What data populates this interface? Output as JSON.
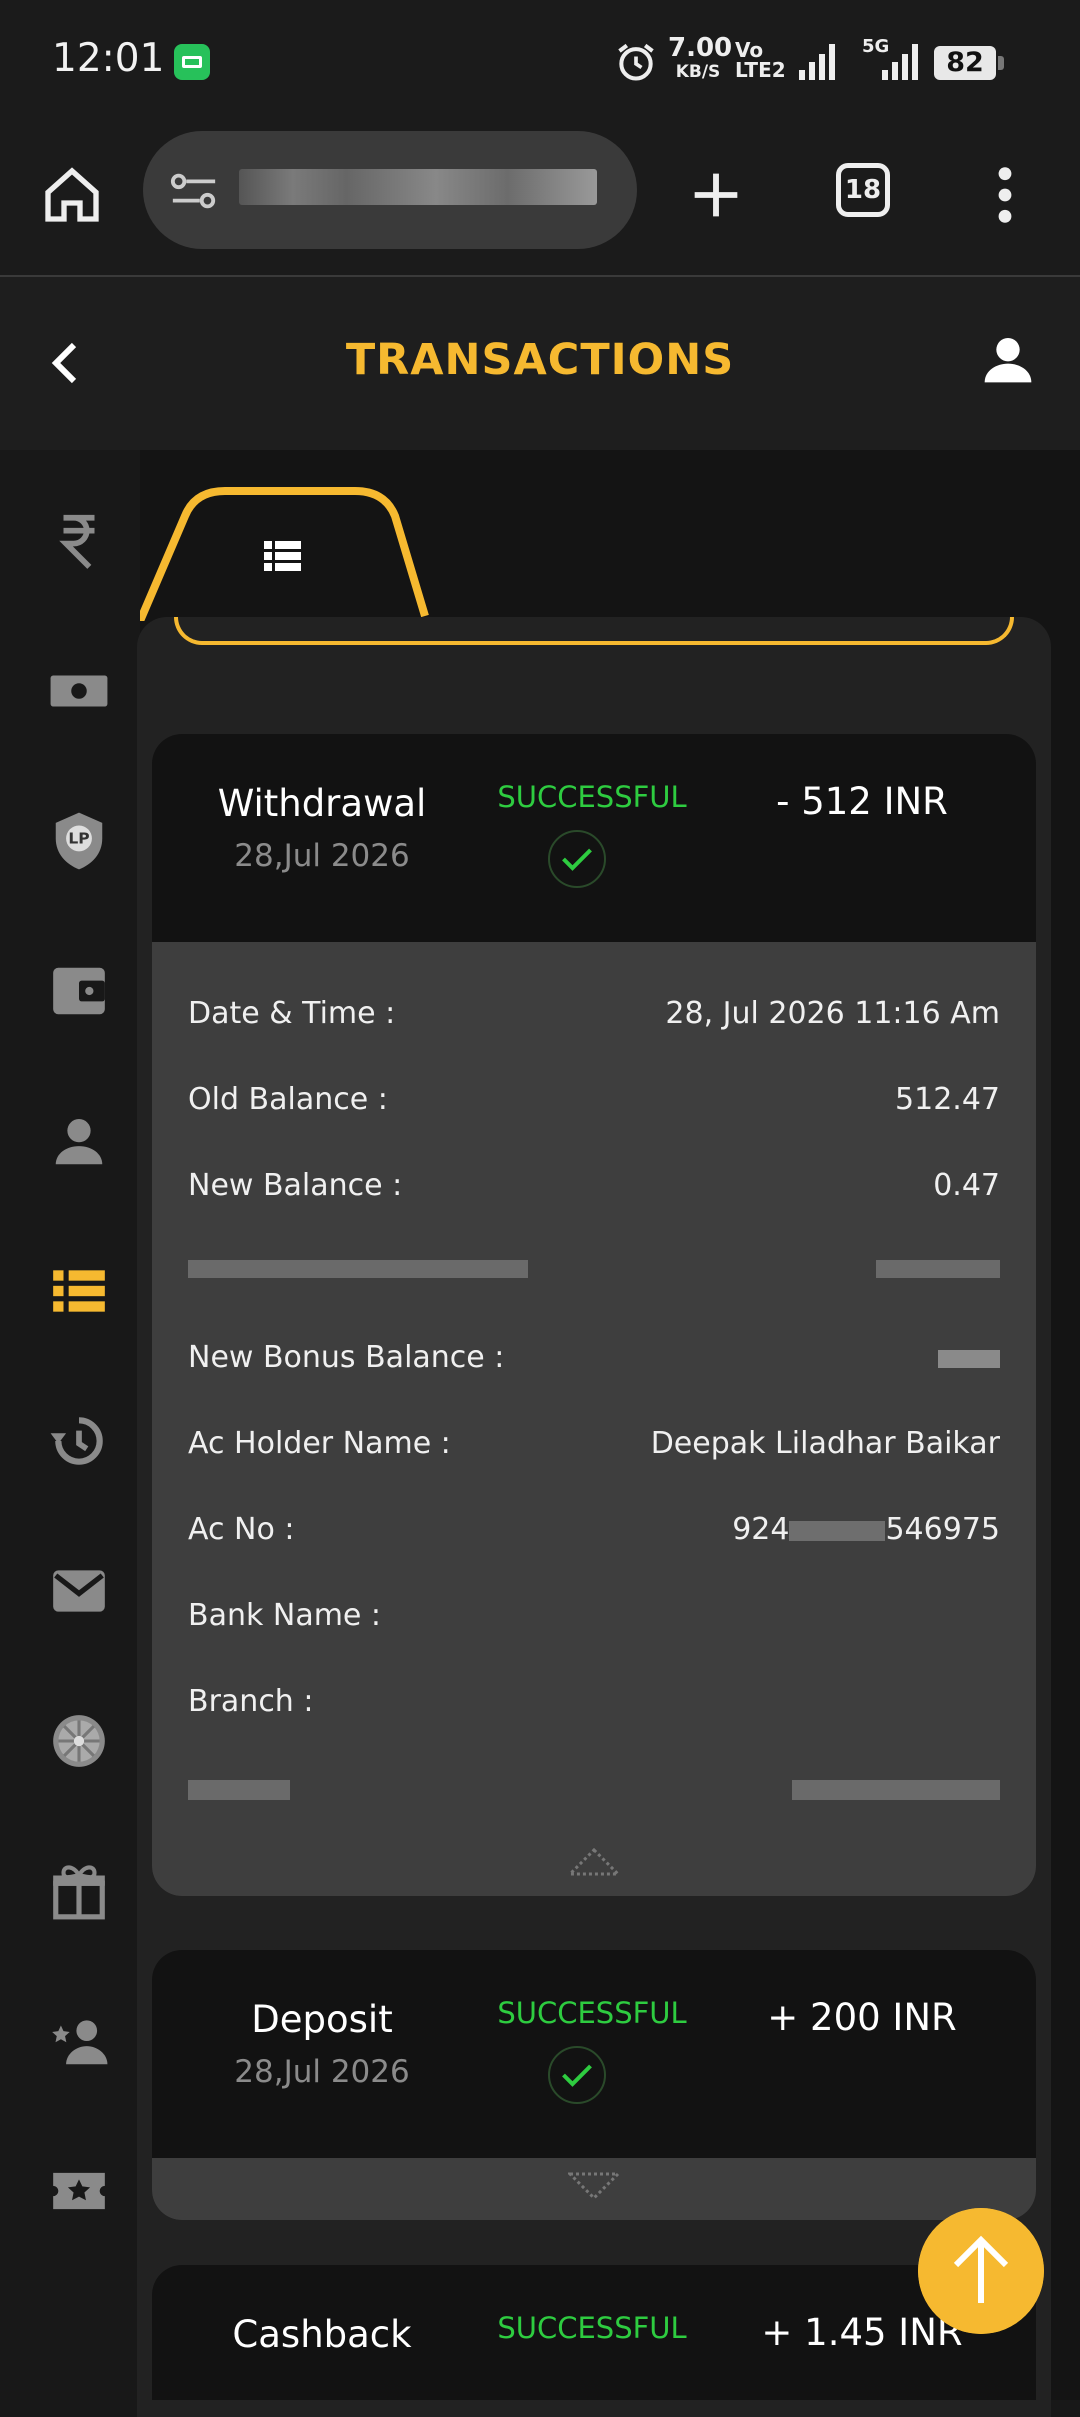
{
  "status_bar": {
    "time": "12:01",
    "net_speed": "7.00",
    "net_speed_unit": "KB/S",
    "volte_top": "Vo",
    "volte_bottom": "LTE2",
    "network_5g": "5G",
    "battery": "82"
  },
  "browser": {
    "tab_count": "18"
  },
  "header": {
    "title": "TRANSACTIONS"
  },
  "sidebar": {
    "items": [
      "rupee",
      "cash",
      "lp-shield",
      "wallet",
      "profile",
      "transactions",
      "history",
      "mail",
      "spin-wheel",
      "gift",
      "refer",
      "rewards"
    ],
    "active_item": "transactions"
  },
  "transactions": [
    {
      "type": "Withdrawal",
      "date": "28,Jul 2026",
      "status": "SUCCESSFUL",
      "amount": "- 512 INR",
      "details": [
        {
          "label": "Date & Time :",
          "value": "28, Jul 2026 11:16 Am"
        },
        {
          "label": "Old Balance :",
          "value": "512.47"
        },
        {
          "label": "New Balance :",
          "value": "0.47"
        },
        {
          "label": "New Bonus Balance :",
          "value": ""
        },
        {
          "label": "Ac Holder Name :",
          "value": "Deepak Liladhar Baikar"
        },
        {
          "label": "Ac No :",
          "value_prefix": "924",
          "value_suffix": "546975"
        },
        {
          "label": "Bank Name :",
          "value": ""
        },
        {
          "label": "Branch :",
          "value": ""
        }
      ]
    },
    {
      "type": "Deposit",
      "date": "28,Jul 2026",
      "status": "SUCCESSFUL",
      "amount": "+ 200 INR"
    },
    {
      "type": "Cashback",
      "status": "SUCCESSFUL",
      "amount": "+ 1.45 INR"
    }
  ],
  "colors": {
    "accent": "#f6b930",
    "success": "#2ecc40",
    "background": "#181818",
    "card": "#121212",
    "details": "#3e3e3e"
  }
}
